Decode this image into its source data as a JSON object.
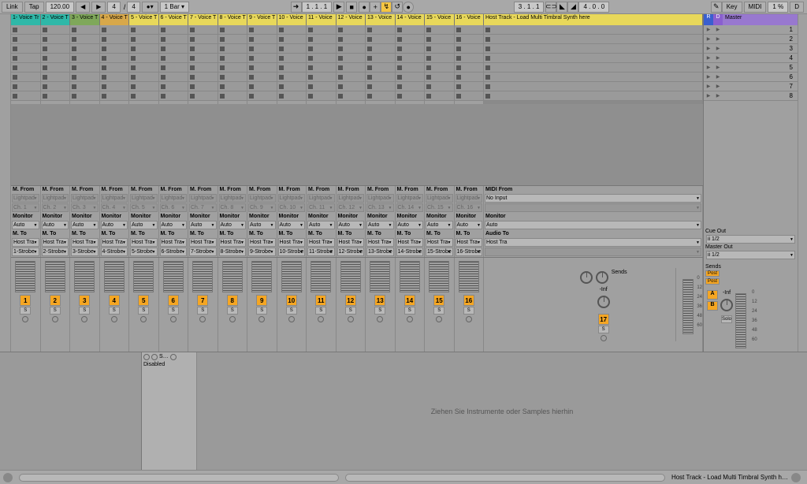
{
  "topbar": {
    "link": "Link",
    "tap": "Tap",
    "tempo": "120.00",
    "nudge_dn": "◀",
    "nudge_up": "▶",
    "sig_num": "4",
    "sig_den": "4",
    "metronome": "●▾",
    "bar": "1 Bar ▾",
    "position": "1 . 1 . 1",
    "play": "▶",
    "stop": "■",
    "record": "●",
    "loop_pos": "3 . 1 . 1",
    "loop_len": "4 . 0 . 0",
    "pencil": "✎",
    "key": "Key",
    "midi": "MIDI",
    "cpu": "1 %",
    "d": "D"
  },
  "tracks": [
    {
      "name": "1- Voice Tr",
      "color": "teal",
      "num": "1"
    },
    {
      "name": "2 - Voice T",
      "color": "teal",
      "num": "2"
    },
    {
      "name": "3 - Voice T",
      "color": "green",
      "num": "3"
    },
    {
      "name": "4 - Voice T",
      "color": "orange",
      "num": "4"
    },
    {
      "name": "5 - Voice T",
      "color": "yellow",
      "num": "5"
    },
    {
      "name": "6 - Voice T",
      "color": "yellow",
      "num": "6"
    },
    {
      "name": "7 - Voice T",
      "color": "yellow",
      "num": "7"
    },
    {
      "name": "8 - Voice T",
      "color": "yellow",
      "num": "8"
    },
    {
      "name": "9 - Voice T",
      "color": "yellow",
      "num": "9"
    },
    {
      "name": "10 - Voice",
      "color": "yellow",
      "num": "10"
    },
    {
      "name": "11 - Voice",
      "color": "yellow",
      "num": "11"
    },
    {
      "name": "12 - Voice",
      "color": "yellow",
      "num": "12"
    },
    {
      "name": "13 - Voice",
      "color": "yellow",
      "num": "13"
    },
    {
      "name": "14 - Voice",
      "color": "yellow",
      "num": "14"
    },
    {
      "name": "15 - Voice",
      "color": "yellow",
      "num": "15"
    },
    {
      "name": "16 - Voice",
      "color": "yellow",
      "num": "16"
    }
  ],
  "host_track": "Host Track - Load Multi Timbral Synth here",
  "host_num": "17",
  "scenes": [
    "1",
    "2",
    "3",
    "4",
    "5",
    "6",
    "7",
    "8"
  ],
  "io": {
    "m_from": "M. From",
    "lightpad": "Lightpad",
    "ch_prefix": "Ch. ",
    "monitor": "Monitor",
    "auto": "Auto",
    "m_to": "M. To",
    "host_tra": "Host Tra",
    "strobe_suffix": "-Strobe",
    "midi_from": "MIDI From",
    "no_input": "No Input",
    "audio_to": "Audio To",
    "host_track_out": "Host Tra"
  },
  "master": {
    "r": "R",
    "d": "D",
    "label": "Master",
    "cue_out": "Cue Out",
    "cue_val": "ii 1/2",
    "master_out": "Master Out",
    "master_val": "ii 1/2",
    "a": "A",
    "b": "B",
    "solo": "Solo",
    "sends": "Sends",
    "post": "Post",
    "inf": "-Inf",
    "db_scale": [
      "0",
      "12",
      "24",
      "36",
      "48",
      "60"
    ]
  },
  "mixer": {
    "solo": "S",
    "sends": "Sends",
    "sends_a": "A",
    "sends_b": "B"
  },
  "device": {
    "title": "S…",
    "state": "Disabled"
  },
  "drop_hint": "Ziehen Sie Instrumente oder Samples hierhin",
  "status_track": "Host Track - Load Multi Timbral Synth h…"
}
